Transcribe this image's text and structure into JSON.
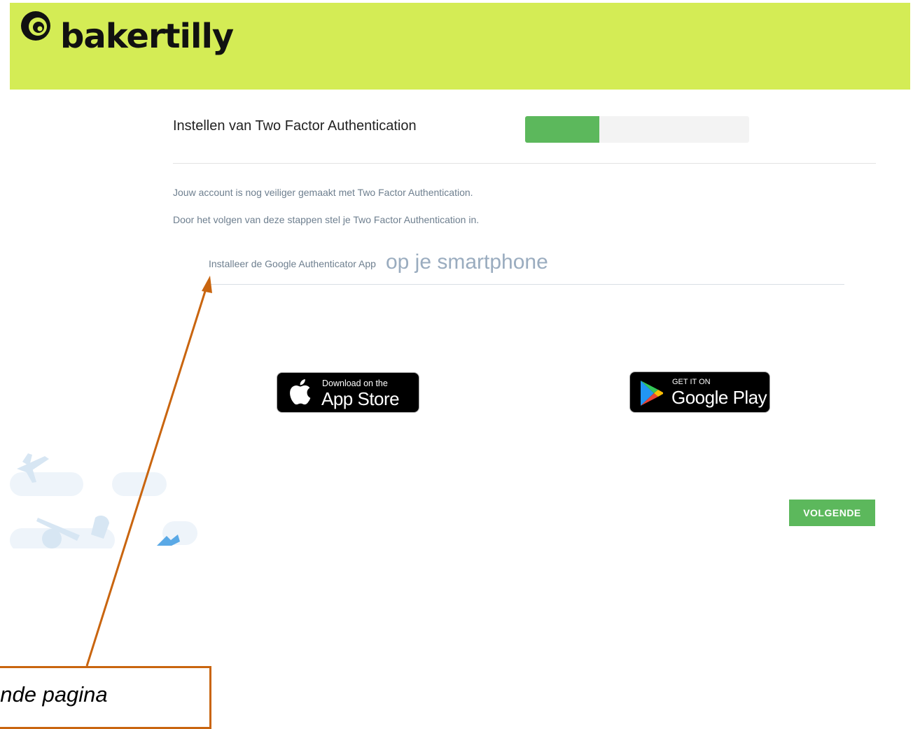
{
  "header": {
    "brand": "bakertilly",
    "logo_icon": "bakertilly-swirl-logo-icon",
    "background": "#d4ec55"
  },
  "main": {
    "title": "Instellen van Two Factor Authentication",
    "progress_fraction": 0.33,
    "intro_line1": "Jouw account is nog veiliger gemaakt met Two Factor Authentication.",
    "intro_line2": "Door het volgen van deze stappen stel je Two Factor Authentication in.",
    "step_small": "Installeer de Google Authenticator App",
    "step_large": "op je smartphone"
  },
  "badges": {
    "apple": {
      "small": "Download on the",
      "big": "App Store",
      "icon": "apple-icon"
    },
    "google": {
      "small": "GET IT ON",
      "big": "Google Play",
      "icon": "google-play-icon"
    }
  },
  "next_button": "VOLGENDE",
  "annotation": {
    "callout_text": "ende pagina",
    "color": "#c9650f"
  },
  "colors": {
    "accent_green": "#5cb85c",
    "muted_text": "#6e7f8f"
  }
}
